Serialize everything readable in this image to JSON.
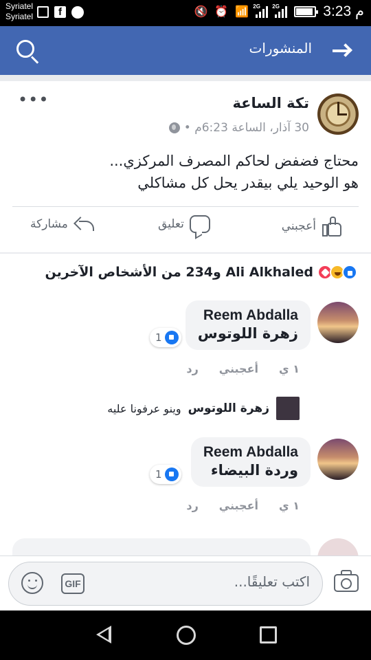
{
  "status_bar": {
    "carrier_1": "Syriatel",
    "carrier_2": "Syriatel",
    "time": "3:23 م",
    "network_1": "2G",
    "network_2": "2G"
  },
  "topbar": {
    "title": "المنشورات",
    "color": "#4267b2"
  },
  "post": {
    "author": "تكة الساعة",
    "timestamp": "30 آذار، الساعة 6:23م •",
    "text": "محتاج فضفض لحاكم المصرف المركزي...\nهو الوحيد يلي بيقدر يحل كل مشاكلي",
    "actions": {
      "like": "أعجبني",
      "comment": "تعليق",
      "share": "مشاركة"
    }
  },
  "reactions": {
    "summary": "Ali Alkhaled و234 من الأشخاص الآخرين",
    "types": [
      "like",
      "haha",
      "love"
    ]
  },
  "comments": [
    {
      "author": "Reem Abdalla",
      "text": "زهرة اللوتوس",
      "likes": "1",
      "actions": {
        "like": "أعجبني",
        "reply": "رد",
        "time": "١ ي"
      },
      "reply": {
        "author": "زهرة اللوتوس",
        "text": "وينو عرفونا عليه"
      }
    },
    {
      "author": "Reem Abdalla",
      "text": "وردة البيضاء",
      "likes": "1",
      "actions": {
        "like": "أعجبني",
        "reply": "رد",
        "time": "١ ي"
      }
    }
  ],
  "composer": {
    "placeholder": "اكتب تعليقًا...",
    "gif_label": "GIF"
  }
}
